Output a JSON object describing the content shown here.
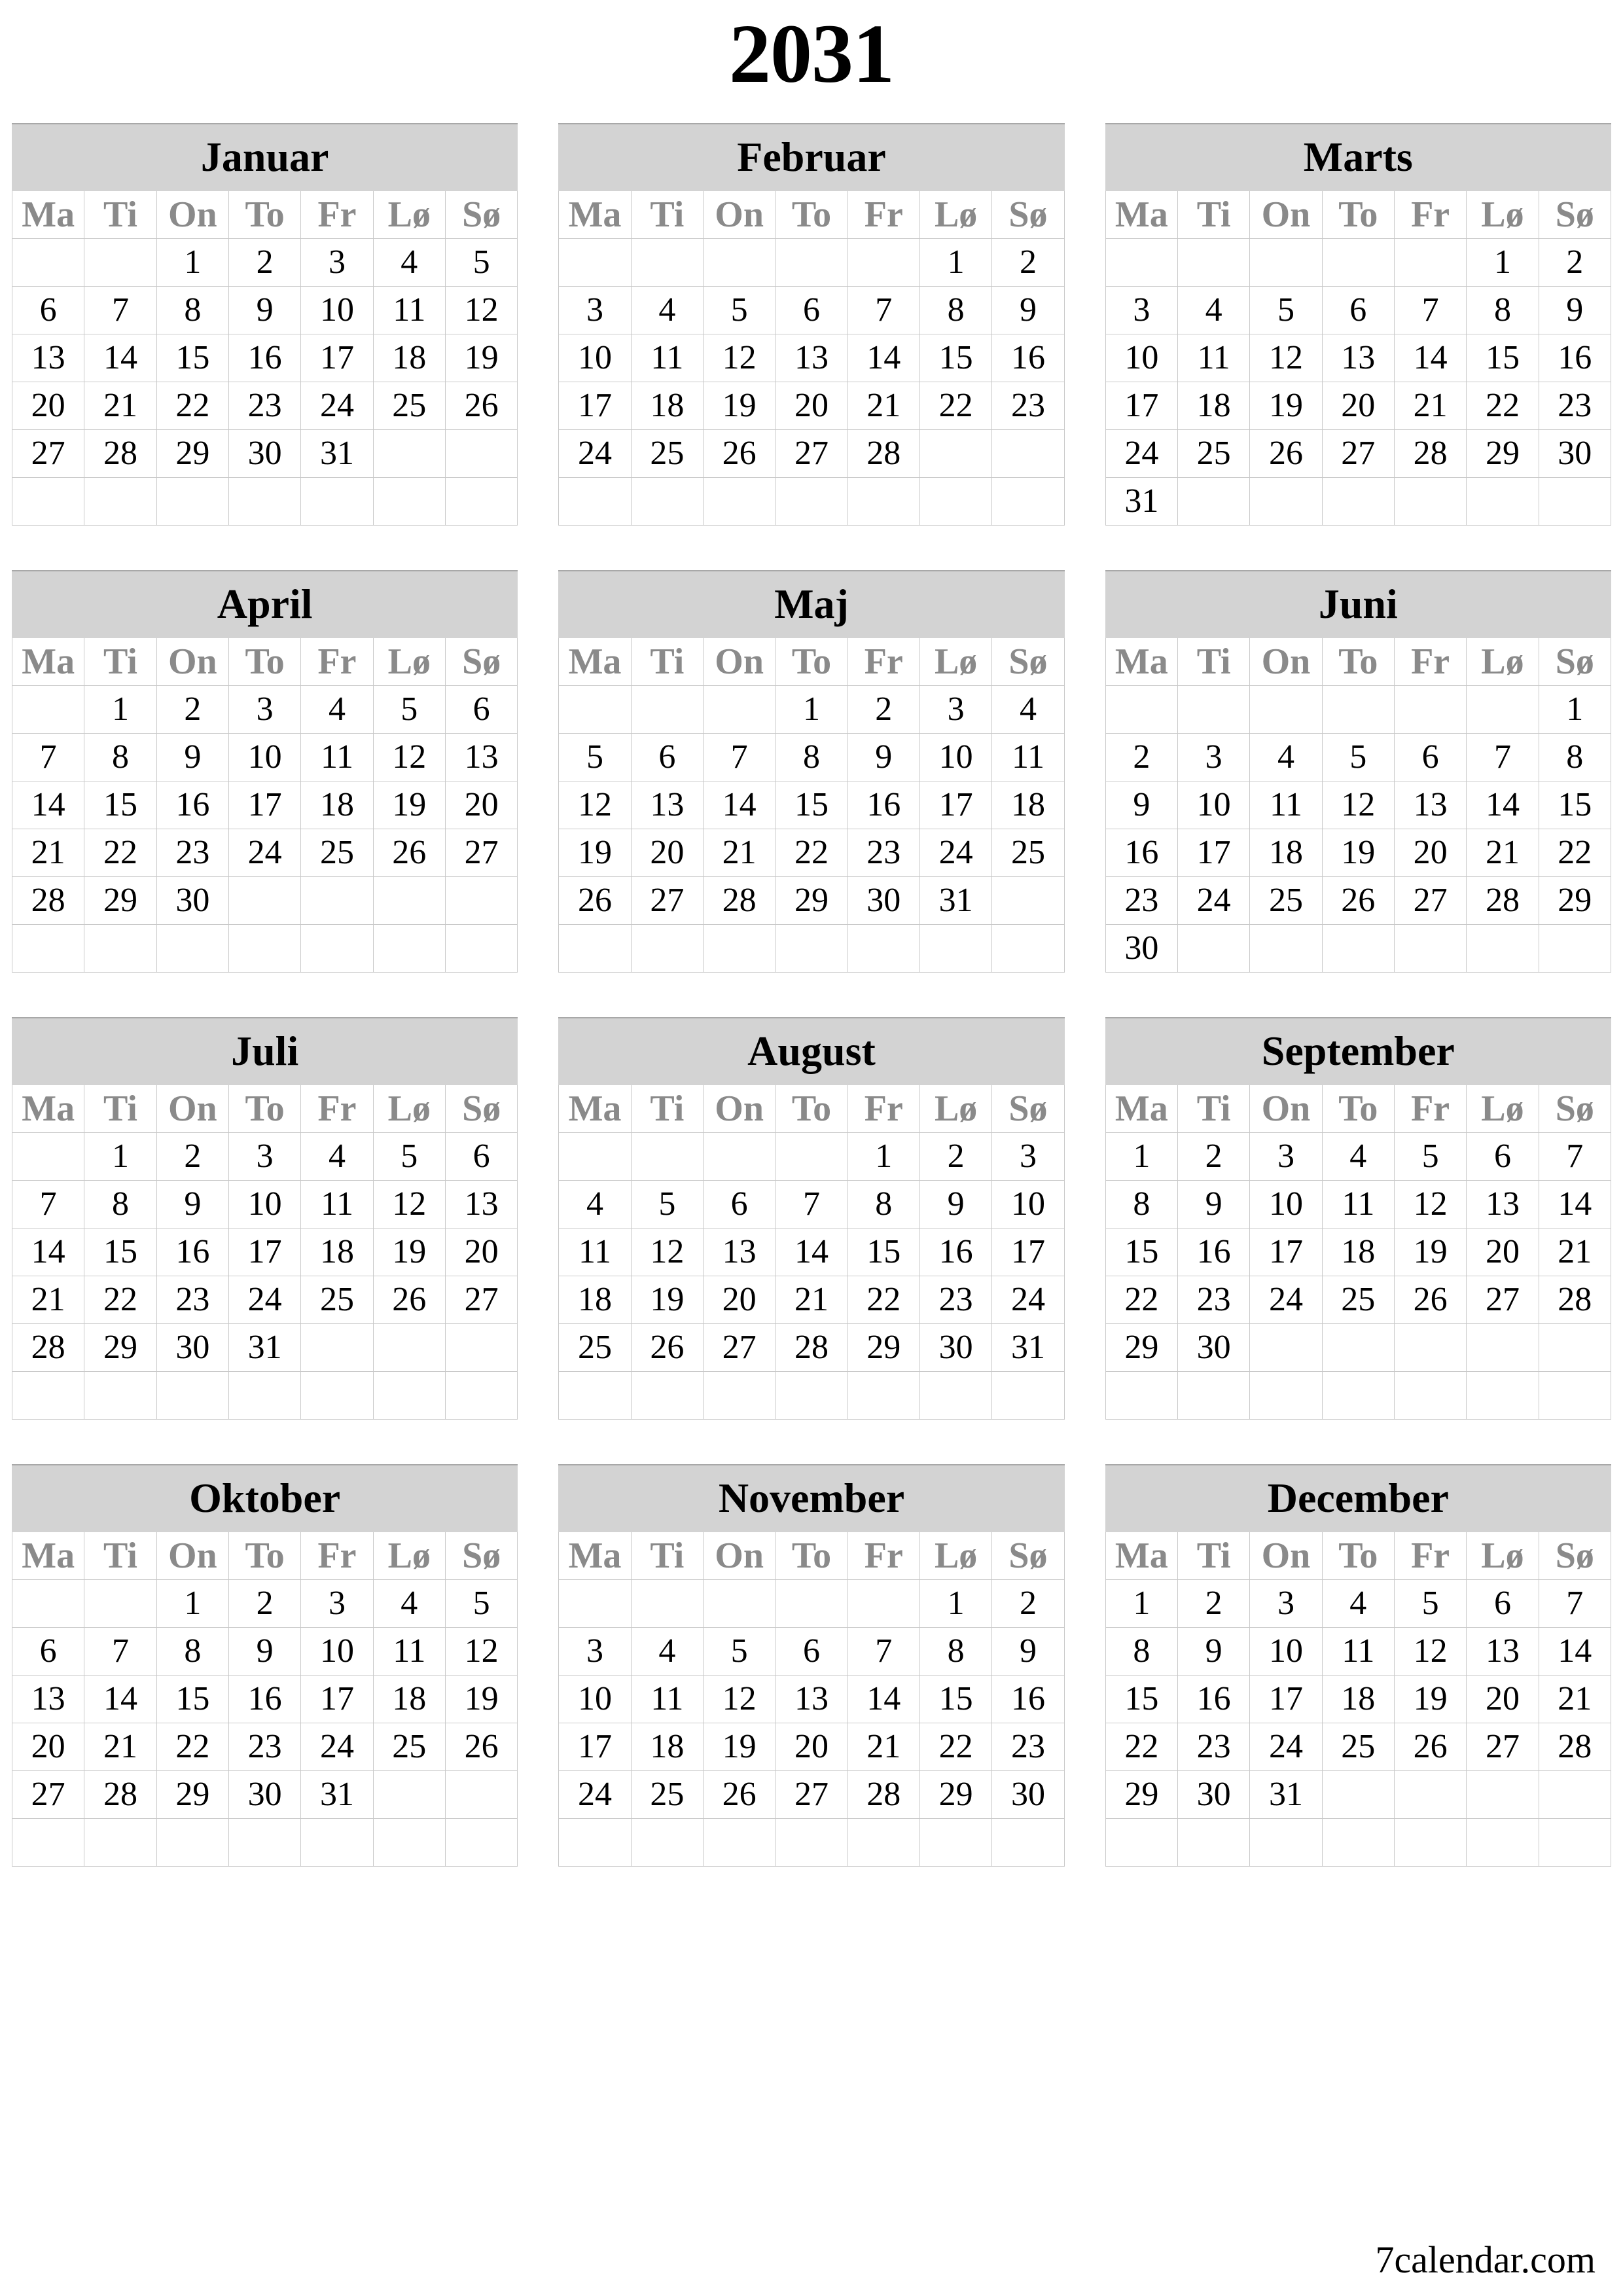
{
  "page": {
    "year_title": "2031",
    "footer_text": "7calendar.com",
    "header_bg": "#d3d3d3",
    "weekday_color": "#8a8a8a",
    "date_color": "#000000",
    "grid_line_color": "#c9c9c9"
  },
  "weekday_headers": [
    "Ma",
    "Ti",
    "On",
    "To",
    "Fr",
    "Lø",
    "Sø"
  ],
  "months": [
    {
      "name": "Januar",
      "weeks": [
        [
          "",
          "",
          "1",
          "2",
          "3",
          "4",
          "5"
        ],
        [
          "6",
          "7",
          "8",
          "9",
          "10",
          "11",
          "12"
        ],
        [
          "13",
          "14",
          "15",
          "16",
          "17",
          "18",
          "19"
        ],
        [
          "20",
          "21",
          "22",
          "23",
          "24",
          "25",
          "26"
        ],
        [
          "27",
          "28",
          "29",
          "30",
          "31",
          "",
          ""
        ],
        [
          "",
          "",
          "",
          "",
          "",
          "",
          ""
        ]
      ]
    },
    {
      "name": "Februar",
      "weeks": [
        [
          "",
          "",
          "",
          "",
          "",
          "1",
          "2"
        ],
        [
          "3",
          "4",
          "5",
          "6",
          "7",
          "8",
          "9"
        ],
        [
          "10",
          "11",
          "12",
          "13",
          "14",
          "15",
          "16"
        ],
        [
          "17",
          "18",
          "19",
          "20",
          "21",
          "22",
          "23"
        ],
        [
          "24",
          "25",
          "26",
          "27",
          "28",
          "",
          ""
        ],
        [
          "",
          "",
          "",
          "",
          "",
          "",
          ""
        ]
      ]
    },
    {
      "name": "Marts",
      "weeks": [
        [
          "",
          "",
          "",
          "",
          "",
          "1",
          "2"
        ],
        [
          "3",
          "4",
          "5",
          "6",
          "7",
          "8",
          "9"
        ],
        [
          "10",
          "11",
          "12",
          "13",
          "14",
          "15",
          "16"
        ],
        [
          "17",
          "18",
          "19",
          "20",
          "21",
          "22",
          "23"
        ],
        [
          "24",
          "25",
          "26",
          "27",
          "28",
          "29",
          "30"
        ],
        [
          "31",
          "",
          "",
          "",
          "",
          "",
          ""
        ]
      ]
    },
    {
      "name": "April",
      "weeks": [
        [
          "",
          "1",
          "2",
          "3",
          "4",
          "5",
          "6"
        ],
        [
          "7",
          "8",
          "9",
          "10",
          "11",
          "12",
          "13"
        ],
        [
          "14",
          "15",
          "16",
          "17",
          "18",
          "19",
          "20"
        ],
        [
          "21",
          "22",
          "23",
          "24",
          "25",
          "26",
          "27"
        ],
        [
          "28",
          "29",
          "30",
          "",
          "",
          "",
          ""
        ],
        [
          "",
          "",
          "",
          "",
          "",
          "",
          ""
        ]
      ]
    },
    {
      "name": "Maj",
      "weeks": [
        [
          "",
          "",
          "",
          "1",
          "2",
          "3",
          "4"
        ],
        [
          "5",
          "6",
          "7",
          "8",
          "9",
          "10",
          "11"
        ],
        [
          "12",
          "13",
          "14",
          "15",
          "16",
          "17",
          "18"
        ],
        [
          "19",
          "20",
          "21",
          "22",
          "23",
          "24",
          "25"
        ],
        [
          "26",
          "27",
          "28",
          "29",
          "30",
          "31",
          ""
        ],
        [
          "",
          "",
          "",
          "",
          "",
          "",
          ""
        ]
      ]
    },
    {
      "name": "Juni",
      "weeks": [
        [
          "",
          "",
          "",
          "",
          "",
          "",
          "1"
        ],
        [
          "2",
          "3",
          "4",
          "5",
          "6",
          "7",
          "8"
        ],
        [
          "9",
          "10",
          "11",
          "12",
          "13",
          "14",
          "15"
        ],
        [
          "16",
          "17",
          "18",
          "19",
          "20",
          "21",
          "22"
        ],
        [
          "23",
          "24",
          "25",
          "26",
          "27",
          "28",
          "29"
        ],
        [
          "30",
          "",
          "",
          "",
          "",
          "",
          ""
        ]
      ]
    },
    {
      "name": "Juli",
      "weeks": [
        [
          "",
          "1",
          "2",
          "3",
          "4",
          "5",
          "6"
        ],
        [
          "7",
          "8",
          "9",
          "10",
          "11",
          "12",
          "13"
        ],
        [
          "14",
          "15",
          "16",
          "17",
          "18",
          "19",
          "20"
        ],
        [
          "21",
          "22",
          "23",
          "24",
          "25",
          "26",
          "27"
        ],
        [
          "28",
          "29",
          "30",
          "31",
          "",
          "",
          ""
        ],
        [
          "",
          "",
          "",
          "",
          "",
          "",
          ""
        ]
      ]
    },
    {
      "name": "August",
      "weeks": [
        [
          "",
          "",
          "",
          "",
          "1",
          "2",
          "3"
        ],
        [
          "4",
          "5",
          "6",
          "7",
          "8",
          "9",
          "10"
        ],
        [
          "11",
          "12",
          "13",
          "14",
          "15",
          "16",
          "17"
        ],
        [
          "18",
          "19",
          "20",
          "21",
          "22",
          "23",
          "24"
        ],
        [
          "25",
          "26",
          "27",
          "28",
          "29",
          "30",
          "31"
        ],
        [
          "",
          "",
          "",
          "",
          "",
          "",
          ""
        ]
      ]
    },
    {
      "name": "September",
      "weeks": [
        [
          "1",
          "2",
          "3",
          "4",
          "5",
          "6",
          "7"
        ],
        [
          "8",
          "9",
          "10",
          "11",
          "12",
          "13",
          "14"
        ],
        [
          "15",
          "16",
          "17",
          "18",
          "19",
          "20",
          "21"
        ],
        [
          "22",
          "23",
          "24",
          "25",
          "26",
          "27",
          "28"
        ],
        [
          "29",
          "30",
          "",
          "",
          "",
          "",
          ""
        ],
        [
          "",
          "",
          "",
          "",
          "",
          "",
          ""
        ]
      ]
    },
    {
      "name": "Oktober",
      "weeks": [
        [
          "",
          "",
          "1",
          "2",
          "3",
          "4",
          "5"
        ],
        [
          "6",
          "7",
          "8",
          "9",
          "10",
          "11",
          "12"
        ],
        [
          "13",
          "14",
          "15",
          "16",
          "17",
          "18",
          "19"
        ],
        [
          "20",
          "21",
          "22",
          "23",
          "24",
          "25",
          "26"
        ],
        [
          "27",
          "28",
          "29",
          "30",
          "31",
          "",
          ""
        ],
        [
          "",
          "",
          "",
          "",
          "",
          "",
          ""
        ]
      ]
    },
    {
      "name": "November",
      "weeks": [
        [
          "",
          "",
          "",
          "",
          "",
          "1",
          "2"
        ],
        [
          "3",
          "4",
          "5",
          "6",
          "7",
          "8",
          "9"
        ],
        [
          "10",
          "11",
          "12",
          "13",
          "14",
          "15",
          "16"
        ],
        [
          "17",
          "18",
          "19",
          "20",
          "21",
          "22",
          "23"
        ],
        [
          "24",
          "25",
          "26",
          "27",
          "28",
          "29",
          "30"
        ],
        [
          "",
          "",
          "",
          "",
          "",
          "",
          ""
        ]
      ]
    },
    {
      "name": "December",
      "weeks": [
        [
          "1",
          "2",
          "3",
          "4",
          "5",
          "6",
          "7"
        ],
        [
          "8",
          "9",
          "10",
          "11",
          "12",
          "13",
          "14"
        ],
        [
          "15",
          "16",
          "17",
          "18",
          "19",
          "20",
          "21"
        ],
        [
          "22",
          "23",
          "24",
          "25",
          "26",
          "27",
          "28"
        ],
        [
          "29",
          "30",
          "31",
          "",
          "",
          "",
          ""
        ],
        [
          "",
          "",
          "",
          "",
          "",
          "",
          ""
        ]
      ]
    }
  ]
}
